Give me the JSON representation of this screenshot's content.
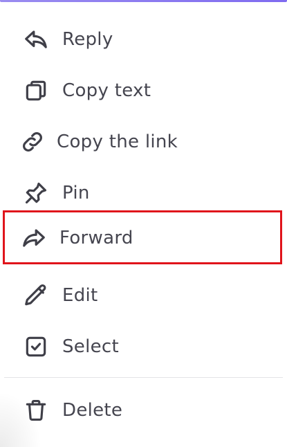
{
  "menu": {
    "items": [
      {
        "label": "Reply",
        "icon": "reply-icon"
      },
      {
        "label": "Copy text",
        "icon": "copy-icon"
      },
      {
        "label": "Copy the link",
        "icon": "link-icon"
      },
      {
        "label": "Pin",
        "icon": "pin-icon"
      },
      {
        "label": "Forward",
        "icon": "forward-icon"
      },
      {
        "label": "Edit",
        "icon": "pencil-icon"
      },
      {
        "label": "Select",
        "icon": "checkbox-icon"
      },
      {
        "label": "Delete",
        "icon": "trash-icon"
      }
    ],
    "highlighted_item": "Forward"
  },
  "colors": {
    "accent": "#8b7cf0",
    "highlight_border": "#e0141b",
    "text": "#45454f",
    "icon": "#3f3f48"
  }
}
